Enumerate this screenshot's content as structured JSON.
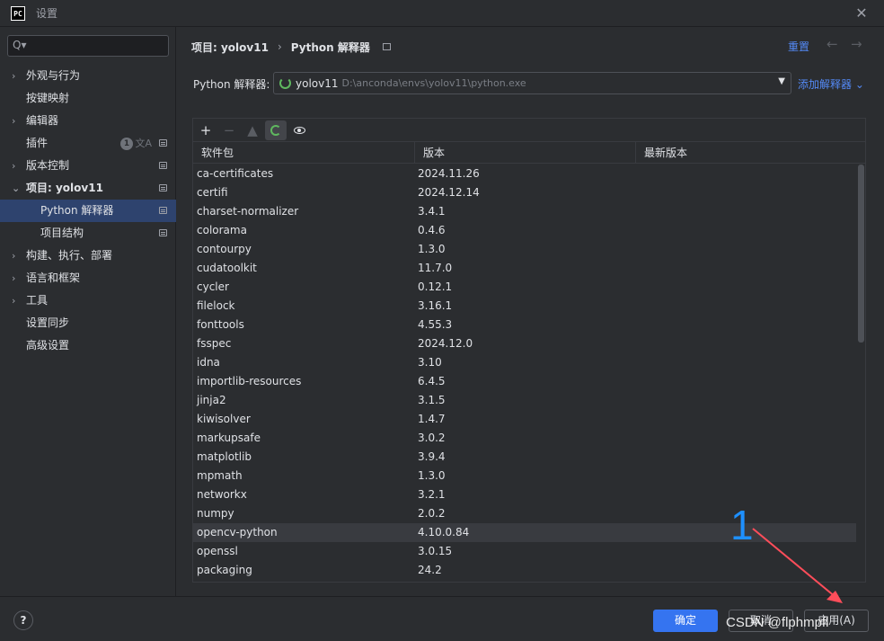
{
  "window": {
    "logo": "PC",
    "title": "设置",
    "close_glyph": "✕"
  },
  "search": {
    "icon_glyph": "Q▾",
    "placeholder": ""
  },
  "sidebar": {
    "items": [
      {
        "label": "外观与行为",
        "chev": "›"
      },
      {
        "label": "按键映射"
      },
      {
        "label": "编辑器",
        "chev": "›"
      },
      {
        "label": "插件",
        "badge": "1",
        "translate_glyph": "文A"
      },
      {
        "label": "版本控制",
        "chev": "›"
      },
      {
        "label": "项目: yolov11",
        "chev": "⌄"
      },
      {
        "label": "Python 解释器"
      },
      {
        "label": "项目结构"
      },
      {
        "label": "构建、执行、部署",
        "chev": "›"
      },
      {
        "label": "语言和框架",
        "chev": "›"
      },
      {
        "label": "工具",
        "chev": "›"
      },
      {
        "label": "设置同步"
      },
      {
        "label": "高级设置"
      }
    ]
  },
  "header": {
    "crumb_project": "项目: yolov11",
    "crumb_sep": "›",
    "crumb_page": "Python 解释器",
    "reset": "重置",
    "back_glyph": "←",
    "forward_glyph": "→"
  },
  "interpreter": {
    "label": "Python 解释器:",
    "name": "yolov11",
    "path": "D:\\anconda\\envs\\yolov11\\python.exe",
    "arrow_glyph": "▼",
    "add_label": "添加解释器 ⌄"
  },
  "toolbar": {
    "add_glyph": "+",
    "remove_glyph": "−",
    "upgrade_glyph": "▲"
  },
  "table": {
    "headers": [
      "软件包",
      "版本",
      "最新版本"
    ],
    "rows": [
      [
        "ca-certificates",
        "2024.11.26"
      ],
      [
        "certifi",
        "2024.12.14"
      ],
      [
        "charset-normalizer",
        "3.4.1"
      ],
      [
        "colorama",
        "0.4.6"
      ],
      [
        "contourpy",
        "1.3.0"
      ],
      [
        "cudatoolkit",
        "11.7.0"
      ],
      [
        "cycler",
        "0.12.1"
      ],
      [
        "filelock",
        "3.16.1"
      ],
      [
        "fonttools",
        "4.55.3"
      ],
      [
        "fsspec",
        "2024.12.0"
      ],
      [
        "idna",
        "3.10"
      ],
      [
        "importlib-resources",
        "6.4.5"
      ],
      [
        "jinja2",
        "3.1.5"
      ],
      [
        "kiwisolver",
        "1.4.7"
      ],
      [
        "markupsafe",
        "3.0.2"
      ],
      [
        "matplotlib",
        "3.9.4"
      ],
      [
        "mpmath",
        "1.3.0"
      ],
      [
        "networkx",
        "3.2.1"
      ],
      [
        "numpy",
        "2.0.2"
      ],
      [
        "opencv-python",
        "4.10.0.84"
      ],
      [
        "openssl",
        "3.0.15"
      ],
      [
        "packaging",
        "24.2"
      ]
    ],
    "highlighted_row": 19
  },
  "footer": {
    "help": "?",
    "ok": "确定",
    "cancel": "取消",
    "apply": "应用(A)"
  },
  "annotation": {
    "number": "1",
    "color": "#1e90ff",
    "arrow_color": "#ff4d5a"
  },
  "watermark": "CSDN @flphmpfl"
}
